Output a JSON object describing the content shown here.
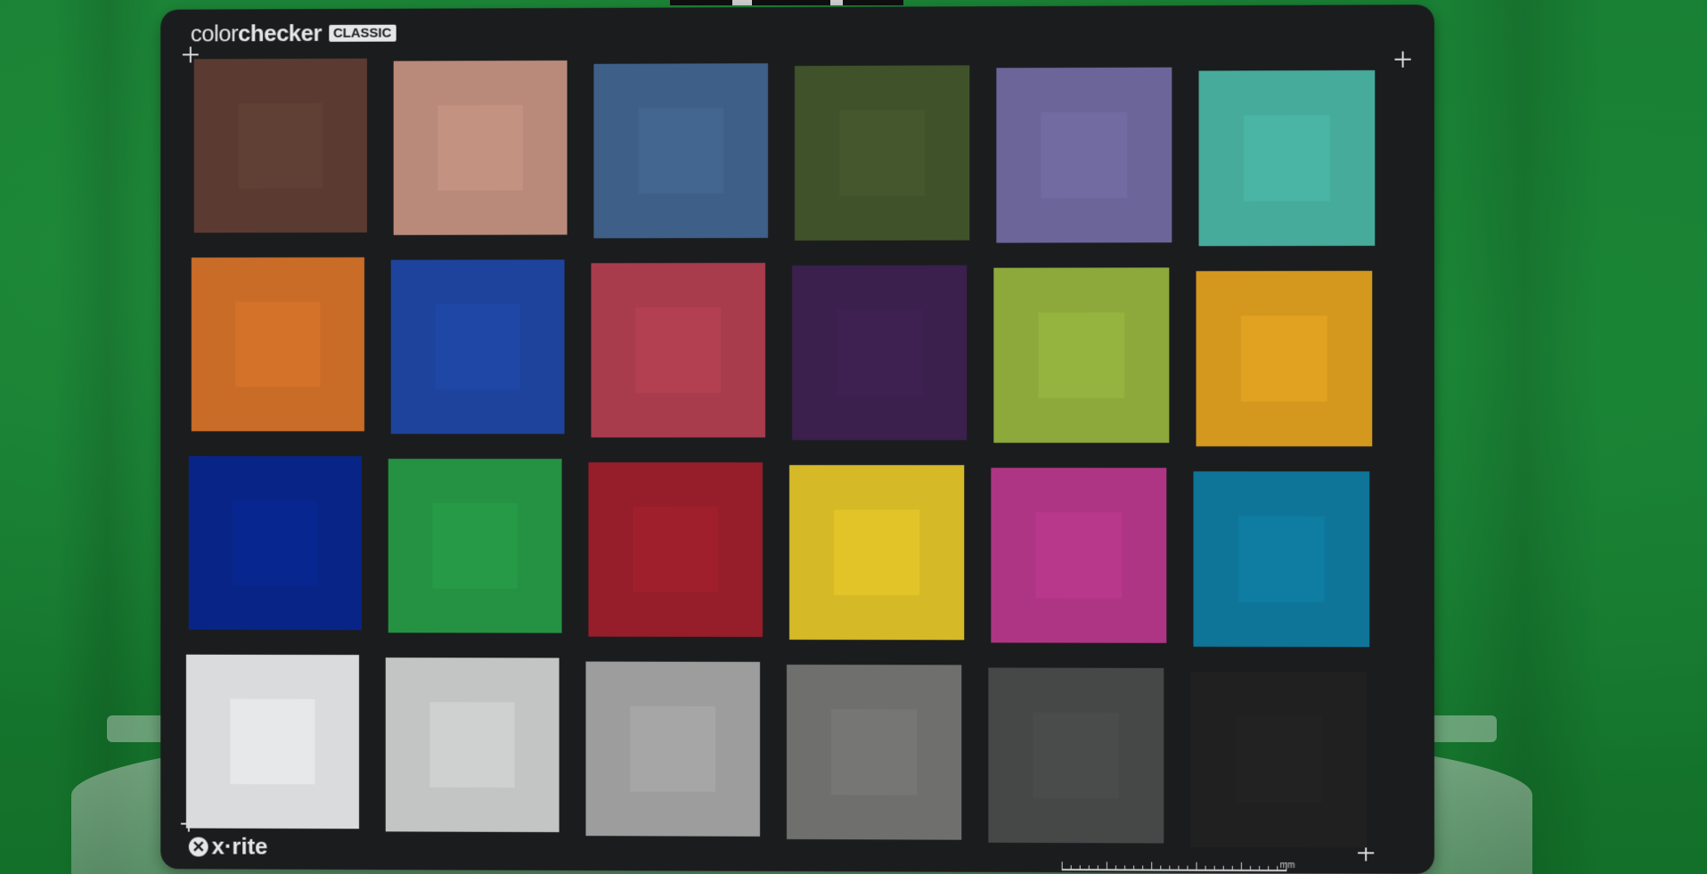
{
  "chart": {
    "brand_part1": "color",
    "brand_part2": "checker",
    "badge": "CLASSIC",
    "maker": "x·rite",
    "ruler_unit": "mm"
  },
  "patch_colors": [
    [
      "#5b3b31",
      "#b98a7a",
      "#3e6088",
      "#40522a",
      "#6b6599",
      "#46ab9b"
    ],
    [
      "#c86c27",
      "#1d439c",
      "#a83c4c",
      "#3b1f4c",
      "#8da93b",
      "#d4981f"
    ],
    [
      "#082487",
      "#259143",
      "#961d2a",
      "#d5b927",
      "#ae3584",
      "#0e7599"
    ],
    [
      "#d9dbdd",
      "#c3c4c4",
      "#9c9d9c",
      "#6f706e",
      "#464747",
      "#202021"
    ]
  ]
}
